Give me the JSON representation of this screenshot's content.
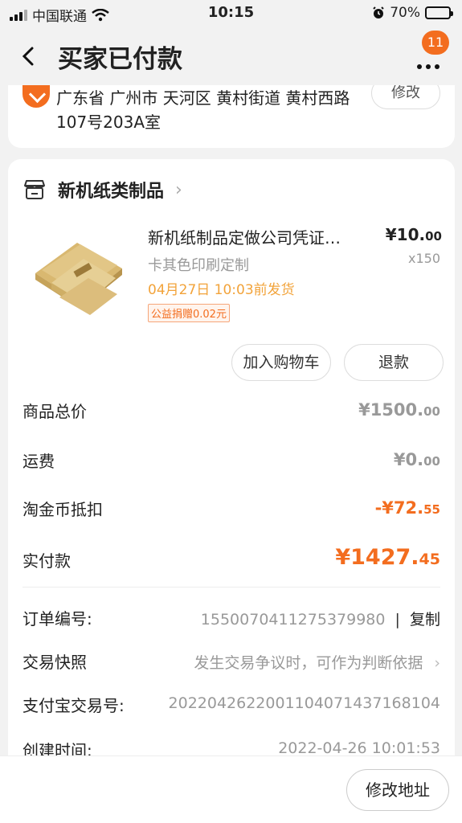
{
  "status_bar": {
    "carrier": "中国联通",
    "time": "10:15",
    "battery_percent": "70%",
    "battery_level": 0.7
  },
  "header": {
    "title": "买家已付款",
    "badge_count": "11"
  },
  "address": {
    "line1": "广东省 广州市 天河区 黄村街道 黄村西路",
    "line2": "107号203A室",
    "edit_label": "修改"
  },
  "shop": {
    "name": "新机纸类制品"
  },
  "product": {
    "name": "新机纸制品定做公司凭证…",
    "price_int": "¥10.",
    "price_dec": "00",
    "spec": "卡其色印刷定制",
    "quantity": "x150",
    "ship_time": "04月27日 10:03前发货",
    "charity": "公益捐赠0.02元"
  },
  "actions": {
    "add_cart": "加入购物车",
    "refund": "退款"
  },
  "summary": {
    "total_label": "商品总价",
    "total_int": "¥1500.",
    "total_dec": "00",
    "shipping_label": "运费",
    "shipping_int": "¥0.",
    "shipping_dec": "00",
    "coin_label": "淘金币抵扣",
    "coin_int": "-¥72.",
    "coin_dec": "55",
    "paid_label": "实付款",
    "paid_int": "¥1427.",
    "paid_dec": "45"
  },
  "details": {
    "order_no_label": "订单编号:",
    "order_no": "1550070411275379980",
    "copy_label": "复制",
    "snapshot_label": "交易快照",
    "snapshot_value": "发生交易争议时，可作为判断依据",
    "alipay_label": "支付宝交易号:",
    "alipay_no": "2022042622001104071437168104",
    "created_label": "创建时间:",
    "created_value": "2022-04-26 10:01:53"
  },
  "bottom": {
    "modify_address": "修改地址"
  }
}
